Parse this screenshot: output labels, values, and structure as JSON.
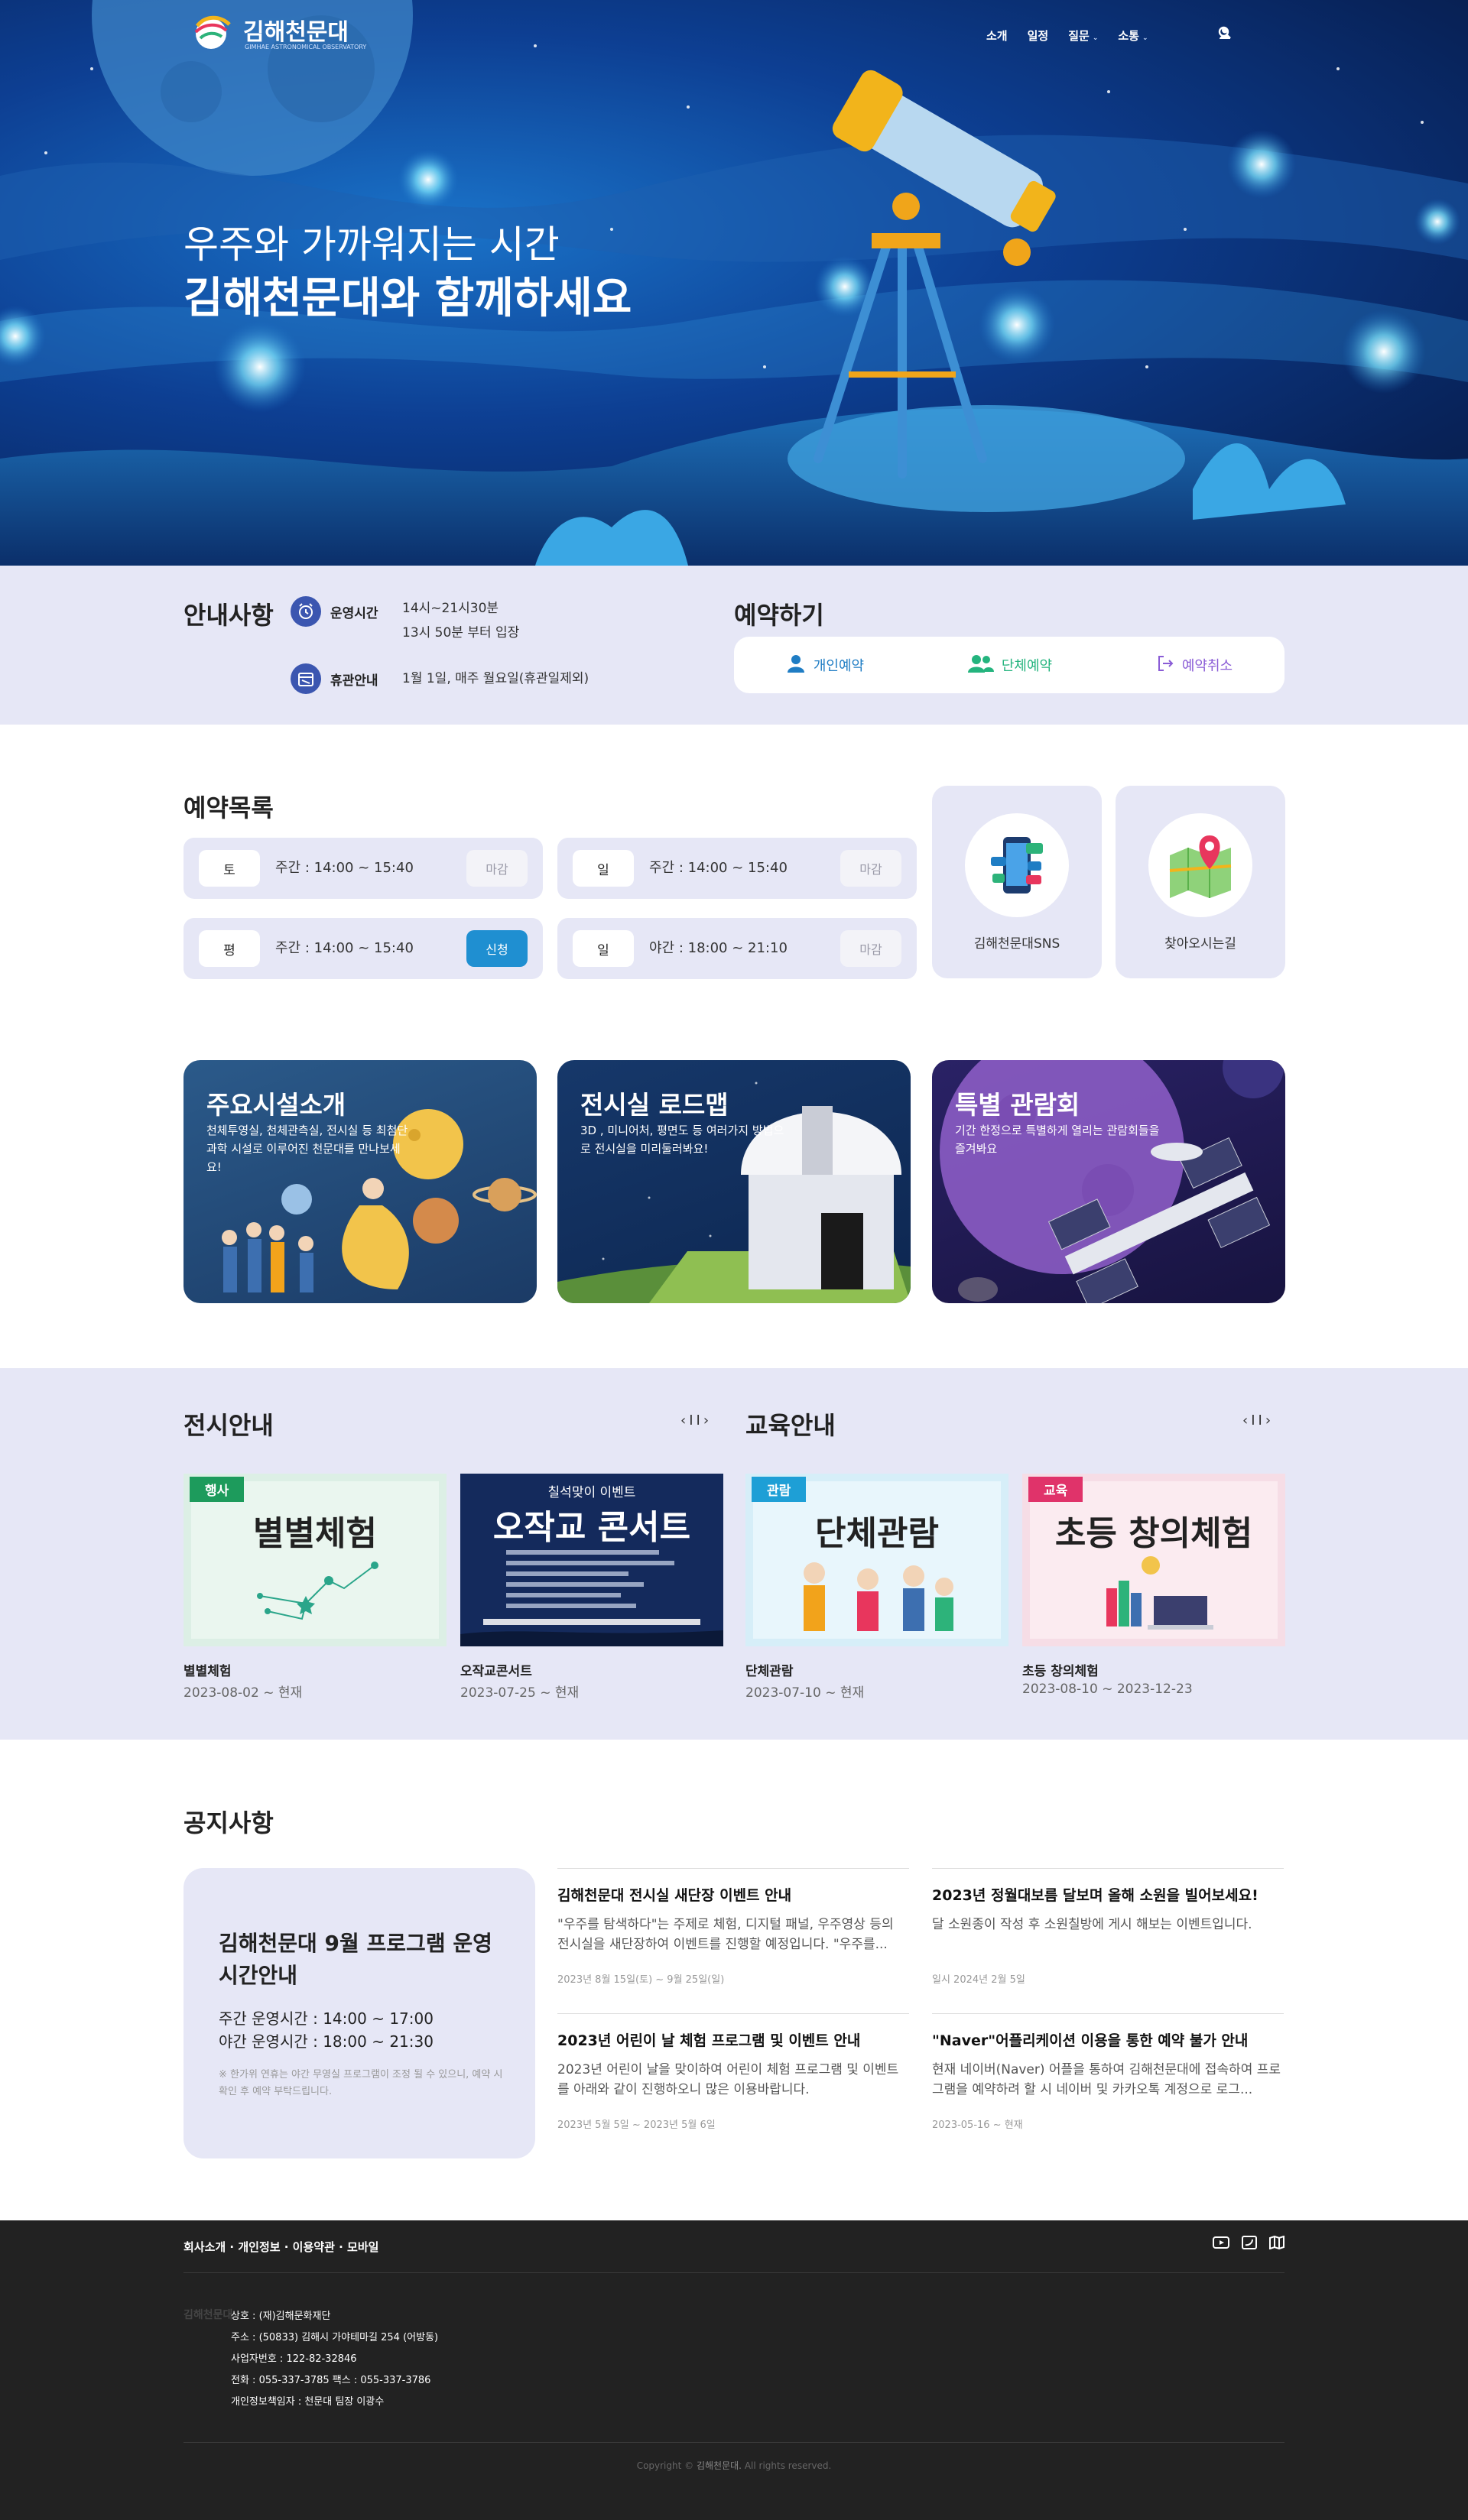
{
  "header": {
    "logo_title": "김해천문대",
    "logo_sub": "GIMHAE ASTRONOMICAL OBSERVATORY",
    "nav": [
      "소개",
      "일정",
      "질문",
      "소통"
    ]
  },
  "hero": {
    "line1": "우주와 가까워지는 시간",
    "line2": "김해천문대와 함께하세요"
  },
  "info": {
    "title": "안내사항",
    "hours_label": "운영시간",
    "hours_line1": "14시~21시30분",
    "hours_line2": "13시 50분 부터 입장",
    "closed_label": "휴관안내",
    "closed_value": "1월 1일, 매주 월요일(휴관일제외)"
  },
  "reservation": {
    "title": "예약하기",
    "individual": "개인예약",
    "group": "단체예약",
    "cancel": "예약취소"
  },
  "reservation_list": {
    "title": "예약목록",
    "slots": [
      {
        "day": "토",
        "time": "주간 : 14:00 ~ 15:40",
        "status": "마감"
      },
      {
        "day": "일",
        "time": "주간 : 14:00 ~ 15:40",
        "status": "마감"
      },
      {
        "day": "평",
        "time": "주간 : 14:00 ~ 15:40",
        "status": "신청"
      },
      {
        "day": "일",
        "time": "야간 : 18:00 ~ 21:10",
        "status": "마감"
      }
    ]
  },
  "quick_links": {
    "sns": "김해천문대SNS",
    "directions": "찾아오시는길"
  },
  "features": [
    {
      "title": "주요시설소개",
      "desc": "천체투영실, 천체관측실, 전시실 등 최첨단 과학 시설로 이루어진 천문대를 만나보세요!"
    },
    {
      "title": "전시실 로드맵",
      "desc": "3D , 미니어처, 평면도 등 여러가지 방법으로 전시실을 미리둘러봐요!"
    },
    {
      "title": "특별 관람회",
      "desc": "기간 한정으로 특별하게 열리는 관람회들을 즐겨봐요"
    }
  ],
  "exhibition": {
    "title": "전시안내",
    "items": [
      {
        "tag": "행사",
        "poster_title": "별별체험",
        "name": "별별체험",
        "date": "2023-08-02 ~ 현재"
      },
      {
        "tag": "칠석맞이 이벤트",
        "poster_title": "오작교 콘서트",
        "name": "오작교콘서트",
        "date": "2023-07-25 ~ 현재"
      }
    ]
  },
  "education": {
    "title": "교육안내",
    "items": [
      {
        "tag": "관람",
        "poster_title": "단체관람",
        "name": "단체관람",
        "date": "2023-07-10 ~ 현재"
      },
      {
        "tag": "교육",
        "poster_title": "초등 창의체험",
        "name": "초등 창의체험",
        "date": "2023-08-10 ~ 2023-12-23"
      }
    ]
  },
  "notices": {
    "title": "공지사항",
    "featured": {
      "headline": "김해천문대 9월 프로그램 운영시간안내",
      "weekday": "주간 운영시간 : 14:00 ~ 17:00",
      "night": "야간 운영시간 : 18:00 ~ 21:30",
      "note": "※ 한가위 연휴는 야간 무영실 프로그램이 조정 될 수 있으니, 예약 시 확인 후 예약 부탁드립니다."
    },
    "items": [
      {
        "title": "김해천문대 전시실 새단장 이벤트 안내",
        "body": "\"우주를 탐색하다\"는 주제로 체험, 디지털 패널, 우주영상 등의 전시실을 새단장하여 이벤트를 진행할 예정입니다. \"우주를...",
        "date": "2023년 8월 15일(토) ~ 9월 25일(일)"
      },
      {
        "title": "2023년 정월대보름 달보며 올해 소원을 빌어보세요!",
        "body": "달 소원종이 작성 후 소원칠방에 게시 해보는 이벤트입니다.",
        "date": "일시 2024년 2월 5일"
      },
      {
        "title": "2023년 어린이 날 체험 프로그램 및 이벤트 안내",
        "body": "2023년 어린이 날을 맞이하여 어린이 체험 프로그램 및 이벤트를 아래와 같이 진행하오니 많은 이용바랍니다.",
        "date": "2023년 5월 5일 ~ 2023년 5월 6일"
      },
      {
        "title": "\"Naver\"어플리케이션 이용을 통한 예약 불가 안내",
        "body": "현재 네이버(Naver) 어플을 통하여 김해천문대에 접속하여 프로그램을 예약하려 할 시 네이버 및 카카오톡 계정으로 로그...",
        "date": "2023-05-16 ~ 현재"
      }
    ]
  },
  "footer": {
    "links": "회사소개 · 개인정보 · 이용약관 · 모바일",
    "logo_text": "김해천문대",
    "info": [
      "상호 : (재)김해문화재단",
      "주소 : (50833) 김해시 가야테마길 254 (어방동)",
      "사업자번호 : 122-82-32846",
      "전화 : 055-337-3785 팩스 : 055-337-3786",
      "개인정보책임자 : 천문대 팀장 이광수"
    ],
    "copyright_prefix": "Copyright ©",
    "copyright_name": "김해천문대.",
    "copyright_suffix": "All rights reserved."
  },
  "colors": {
    "accent": "#1f8fd1",
    "panel": "#e6e7f6",
    "footer": "#222222",
    "icon_blue": "#3b56b0"
  }
}
